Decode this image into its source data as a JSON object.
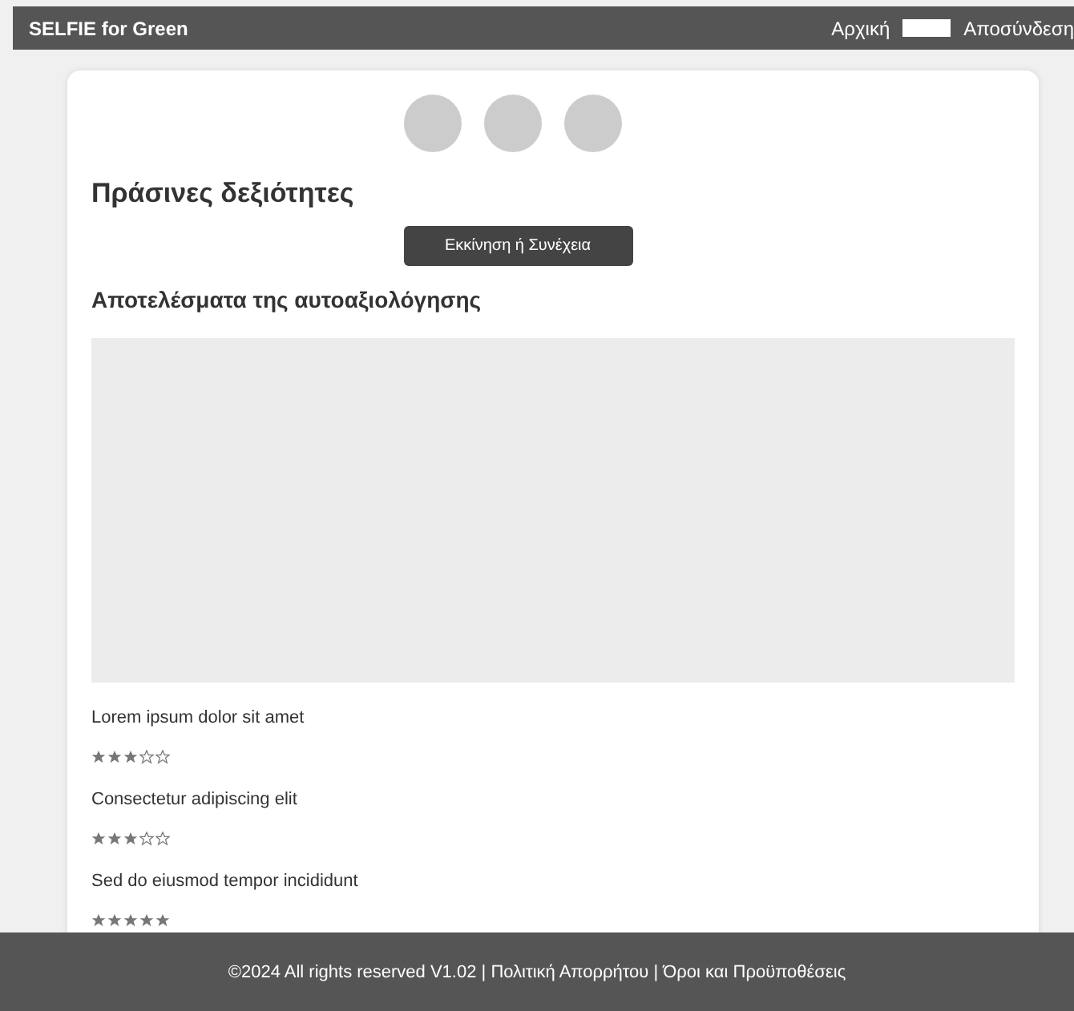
{
  "header": {
    "brand": "SELFIE for Green",
    "links": [
      {
        "kind": "link",
        "label": "Αρχική"
      },
      {
        "kind": "blank"
      },
      {
        "kind": "link",
        "label": "Αποσύνδεση"
      }
    ]
  },
  "steps": [
    {
      "kind": "circle"
    },
    {
      "kind": "circle"
    },
    {
      "kind": "circle"
    }
  ],
  "title": "Πράσινες δεξιότητες",
  "start_button": "Εκκίνηση ή Συνέχεια",
  "results_heading": "Αποτελέσματα της αυτοαξιολόγησης",
  "results": [
    {
      "label": "Lorem ipsum dolor sit amet",
      "stars": 3
    },
    {
      "label": "Consectetur adipiscing elit",
      "stars": 3
    },
    {
      "label": "Sed do eiusmod tempor incididunt",
      "stars": 5
    }
  ],
  "footer": "©2024 All rights reserved V1.02 | Πολιτική Απορρήτου | Όροι και Προϋποθέσεις"
}
